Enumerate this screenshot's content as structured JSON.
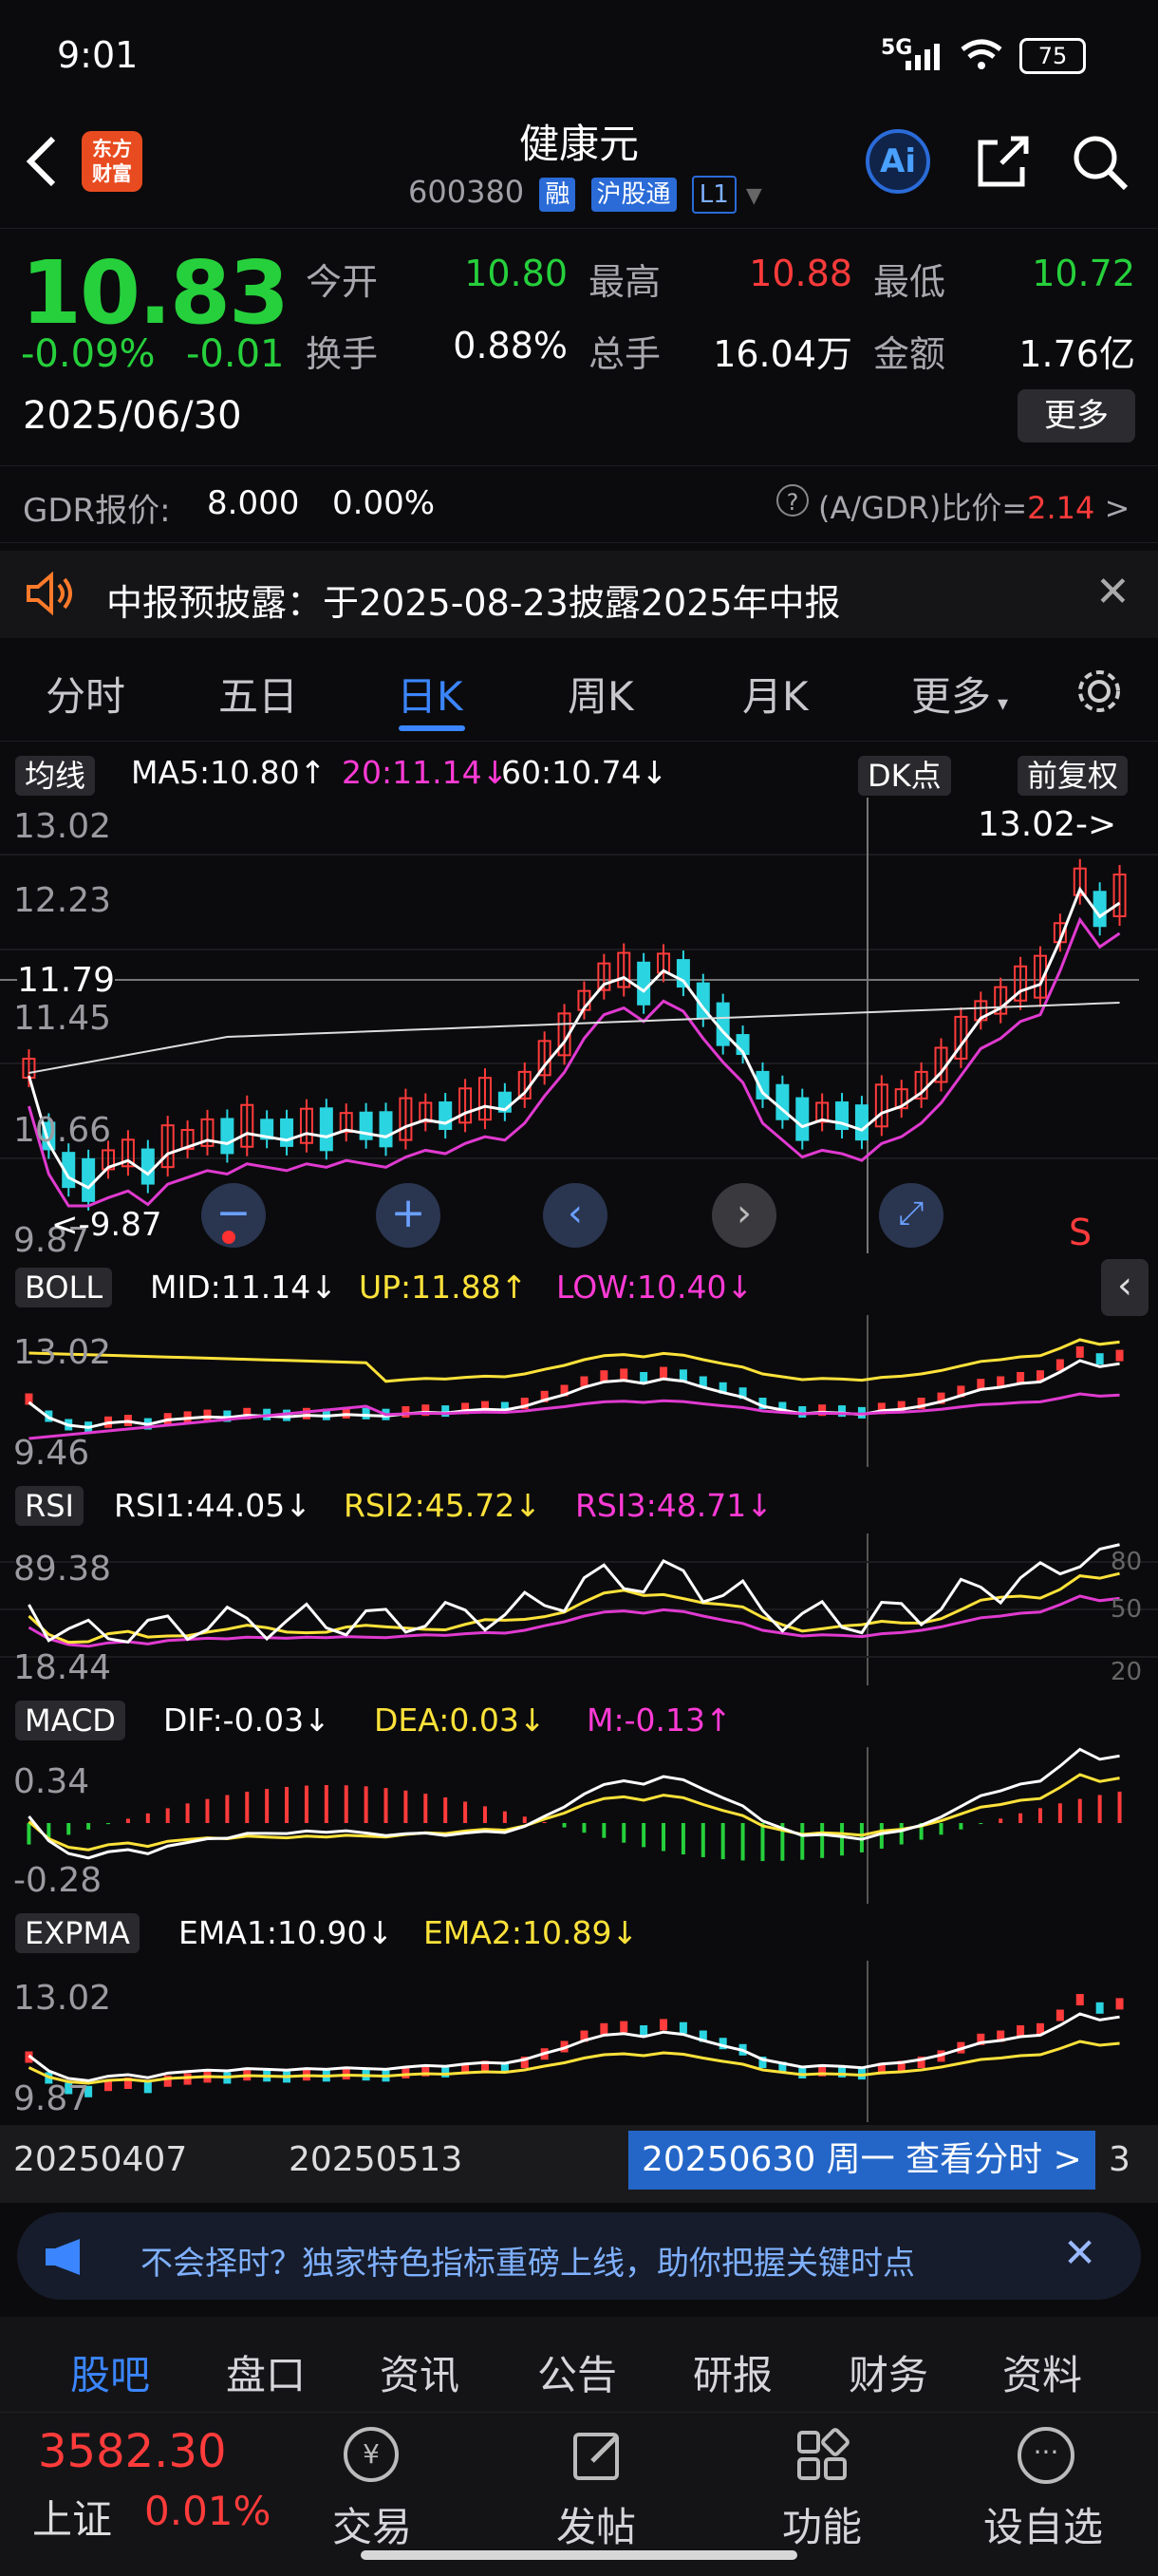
{
  "status_bar": {
    "time": "9:01",
    "network": "5G",
    "battery": "75"
  },
  "header": {
    "logo_text_1": "东方",
    "logo_text_2": "财富",
    "title": "健康元",
    "code": "600380",
    "tags": [
      "融",
      "沪股通",
      "L1"
    ],
    "ai_label": "Ai"
  },
  "quote": {
    "price": "10.83",
    "change_pct": "-0.09%",
    "change": "-0.01",
    "date": "2025/06/30",
    "stats": [
      {
        "label": "今开",
        "value": "10.80",
        "color": "#26d03c"
      },
      {
        "label": "最高",
        "value": "10.88",
        "color": "#ff3b3b"
      },
      {
        "label": "最低",
        "value": "10.72",
        "color": "#26d03c"
      },
      {
        "label": "换手",
        "value": "0.88%",
        "color": "#ffffff"
      },
      {
        "label": "总手",
        "value": "16.04万",
        "color": "#ffffff"
      },
      {
        "label": "金额",
        "value": "1.76亿",
        "color": "#ffffff"
      }
    ],
    "more_label": "更多"
  },
  "gdr": {
    "label": "GDR报价:",
    "price": "8.000",
    "pct": "0.00%",
    "ratio_label": "(A/GDR)比价=",
    "ratio": "2.14"
  },
  "notice": {
    "text": "中报预披露：于2025-08-23披露2025年中报"
  },
  "tabs": [
    "分时",
    "五日",
    "日K",
    "周K",
    "月K",
    "更多"
  ],
  "active_tab": "日K",
  "kline": {
    "selector": "均线",
    "ma5": "MA5:10.80↑",
    "ma20": "20:11.14↓",
    "ma60": "60:10.74↓",
    "dk_label": "DK点",
    "fq_label": "前复权",
    "y_labels": [
      "13.02",
      "12.23",
      "11.45",
      "10.66",
      "9.87"
    ],
    "crosshair_value": "11.79",
    "max_label": "13.02->",
    "min_label": "<-9.87",
    "signal": "S"
  },
  "boll": {
    "name": "BOLL",
    "mid": "MID:11.14↓",
    "up": "UP:11.88↑",
    "low": "LOW:10.40↓",
    "y_labels": [
      "13.02",
      "9.46"
    ]
  },
  "rsi": {
    "name": "RSI",
    "rsi1": "RSI1:44.05↓",
    "rsi2": "RSI2:45.72↓",
    "rsi3": "RSI3:48.71↓",
    "y_labels": [
      "89.38",
      "18.44"
    ],
    "levels": [
      "80",
      "50",
      "20"
    ]
  },
  "macd": {
    "name": "MACD",
    "dif": "DIF:-0.03↓",
    "dea": "DEA:0.03↓",
    "m": "M:-0.13↑",
    "y_labels": [
      "0.34",
      "-0.28"
    ]
  },
  "expma": {
    "name": "EXPMA",
    "ema1": "EMA1:10.90↓",
    "ema2": "EMA2:10.89↓",
    "y_labels": [
      "13.02",
      "9.87"
    ]
  },
  "xaxis": {
    "d1": "20250407",
    "d2": "20250513",
    "cursor": "20250630 周一 查看分时 >",
    "tail": "3"
  },
  "ad": {
    "text": "不会择时？独家特色指标重磅上线，助你把握关键时点"
  },
  "subnav": [
    "股吧",
    "盘口",
    "资讯",
    "公告",
    "研报",
    "财务",
    "资料"
  ],
  "bottom": {
    "index_value": "3582.30",
    "index_name": "上证",
    "index_pct": "0.01%",
    "items": [
      "交易",
      "发帖",
      "功能",
      "设自选"
    ]
  }
}
